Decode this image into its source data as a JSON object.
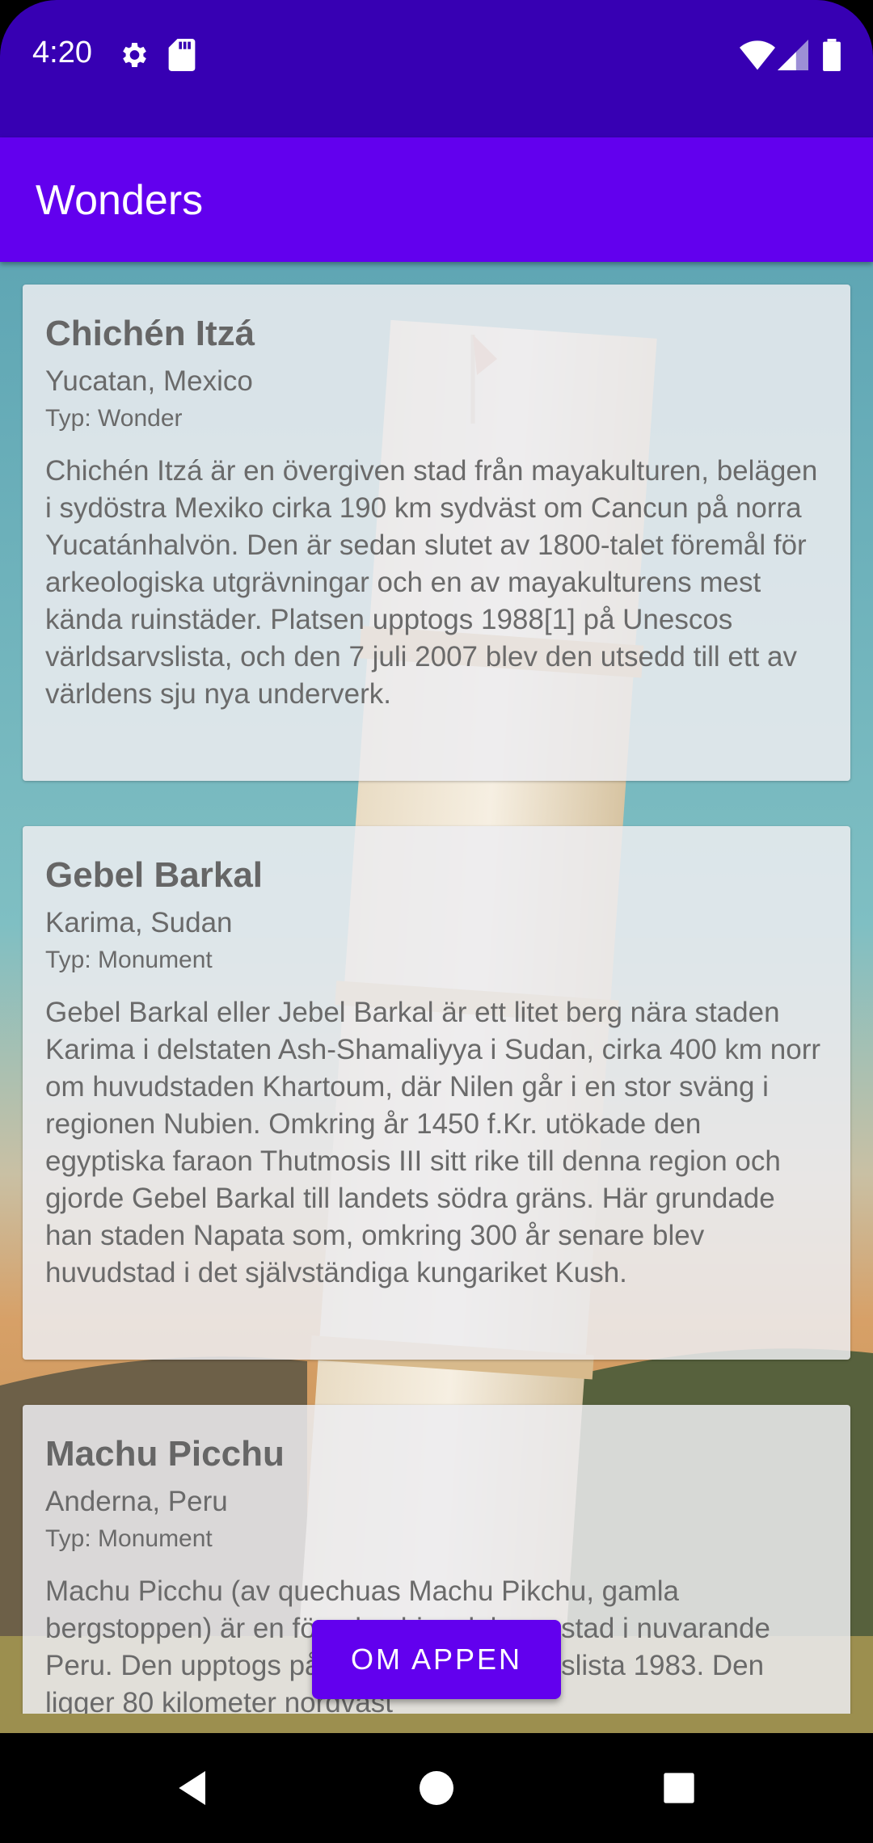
{
  "status_bar": {
    "time": "4:20",
    "left_icons": [
      "gear-icon",
      "sd-card-icon"
    ],
    "right_icons": [
      "wifi-icon",
      "cell-signal-icon",
      "battery-icon"
    ]
  },
  "app_bar": {
    "title": "Wonders"
  },
  "colors": {
    "status_bar": "#3700b3",
    "app_bar": "#6200ee",
    "button": "#6200ee"
  },
  "wonders": [
    {
      "name": "Chichén Itzá",
      "location": "Yucatan, Mexico",
      "type": "Typ: Wonder",
      "description": "Chichén Itzá är en övergiven stad från mayakulturen, belägen i sydöstra Mexiko cirka 190 km sydväst om Cancun på norra Yucatánhalvön. Den är sedan slutet av 1800-talet föremål för arkeologiska utgrävningar och en av mayakulturens mest kända ruinstäder. Platsen upptogs 1988[1] på Unescos världsarvslista, och den 7 juli 2007 blev den utsedd till ett av världens sju nya underverk."
    },
    {
      "name": "Gebel Barkal",
      "location": "Karima, Sudan",
      "type": "Typ: Monument",
      "description": "Gebel Barkal eller Jebel Barkal är ett litet berg nära staden Karima i delstaten Ash-Shamaliyya i Sudan, cirka 400 km norr om huvudstaden Khartoum, där Nilen går i en stor sväng i regionen Nubien. Omkring år 1450 f.Kr. utökade den egyptiska faraon Thutmosis III sitt rike till denna region och gjorde Gebel Barkal till landets södra gräns. Här grundade han staden Napata som, omkring 300 år senare blev huvudstad i det självständiga kungariket Kush."
    },
    {
      "name": "Machu Picchu",
      "location": "Anderna, Peru",
      "type": "Typ: Monument",
      "description": "Machu Picchu (av quechuas Machu Pikchu, gamla bergstoppen) är en förcolumbiansk bergsstad i nuvarande Peru. Den upptogs på Unescos världsarvslista 1983. Den ligger 80 kilometer nordväst"
    }
  ],
  "about_button": {
    "label": "OM APPEN"
  },
  "nav_bar": {
    "buttons": [
      "back-icon",
      "home-icon",
      "recents-icon"
    ]
  }
}
